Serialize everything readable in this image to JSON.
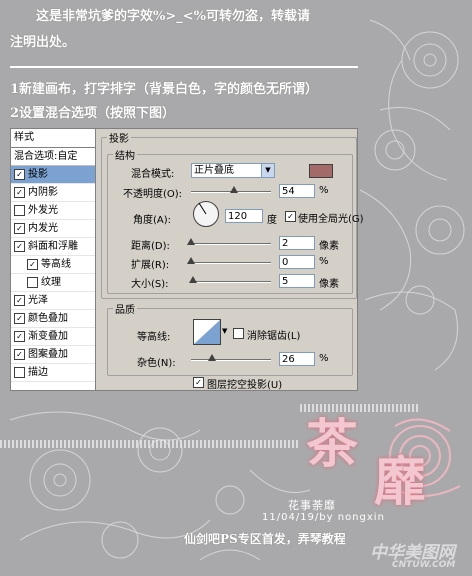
{
  "intro": {
    "line1": "这是非常坑爹的字效%>_<%可转勿盗，转载请",
    "line2": "注明出处。",
    "step1": "1新建画布，打字排字（背景白色，字的颜色无所谓）",
    "step2": "2设置混合选项（按照下图）"
  },
  "panel": {
    "title": "样式",
    "subtitle": "混合选项:自定",
    "items": [
      {
        "label": "投影",
        "checked": "✓",
        "selected": true
      },
      {
        "label": "内阴影",
        "checked": "✓"
      },
      {
        "label": "外发光",
        "checked": ""
      },
      {
        "label": "内发光",
        "checked": "✓"
      },
      {
        "label": "斜面和浮雕",
        "checked": "✓"
      },
      {
        "label": "等高线",
        "checked": "✓"
      },
      {
        "label": "纹理",
        "checked": ""
      },
      {
        "label": "光泽",
        "checked": "✓"
      },
      {
        "label": "颜色叠加",
        "checked": "✓"
      },
      {
        "label": "渐变叠加",
        "checked": "✓"
      },
      {
        "label": "图案叠加",
        "checked": "✓"
      },
      {
        "label": "描边",
        "checked": ""
      }
    ]
  },
  "dropshadow": {
    "section_title": "投影",
    "structure_title": "结构",
    "blend_mode_label": "混合模式:",
    "blend_mode_value": "正片叠底",
    "shadow_color": "#a36a6a",
    "opacity_label": "不透明度(O):",
    "opacity_value": "54",
    "opacity_unit": "%",
    "opacity_level": 54,
    "angle_label": "角度(A):",
    "angle_value": "120",
    "angle_unit": "度",
    "use_global_light_label": "使用全局光(G)",
    "use_global_light_checked": "✓",
    "distance_label": "距离(D):",
    "distance_value": "2",
    "distance_unit": "像素",
    "distance_level": 2,
    "spread_label": "扩展(R):",
    "spread_value": "0",
    "spread_unit": "%",
    "spread_level": 0,
    "size_label": "大小(S):",
    "size_value": "5",
    "size_unit": "像素",
    "size_level": 5,
    "quality_title": "品质",
    "contour_label": "等高线:",
    "anti_alias_label": "消除锯齿(L)",
    "anti_alias_checked": "",
    "noise_label": "杂色(N):",
    "noise_value": "26",
    "noise_unit": "%",
    "noise_level": 26,
    "knockout_label": "图层挖空投影(U)",
    "knockout_checked": "✓"
  },
  "artwork": {
    "big_char_1": "茶",
    "big_char_2": "靡",
    "caption": "花事荼靡",
    "signature": "11/04/19/by nongxin",
    "footer": "仙剑吧PS专区首发，弄琴教程",
    "watermark": "中华美图网",
    "watermark_sub": "CNTUW.COM"
  }
}
